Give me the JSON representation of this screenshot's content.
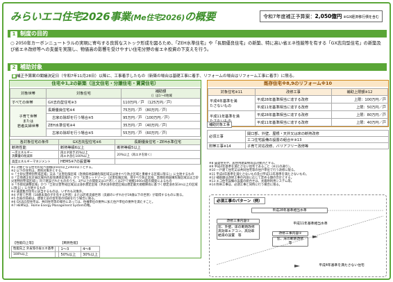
{
  "title": {
    "main": "みらいエコ住宅2026事業",
    "sub": "(Me住宅2026)",
    "tail": "の概要"
  },
  "budget": {
    "label": "令和7年度補正予算案：",
    "amount": "2,050億円",
    "note": "※GX経済移行債を含む"
  },
  "sections": {
    "s1_num": "1",
    "s1": "制度の目的",
    "s2_num": "2",
    "s2": "補助対象"
  },
  "purpose": "○ 2050年カーボンニュートラルの実現に寄与する良質なストック形成を図るため、「ZEH水準住宅」や「長期優良住宅」の新築、特に高い省エネ性能等を有する「GX志向型住宅」の新築及び省エネ改修等への支援を実施し、物価高の影響を受けやすい住宅分野の省エネ投資の下支えを行う。",
  "note1": {
    "tag": "■",
    "text": "補正予算案の閣議決定日（令和7年11月28日）以降に、工事着手したもの（新築の場合は基礎工事に着手、リフォームの場合はリフォーム工事に着手）に限る。"
  },
  "new": {
    "heading": "住宅※1,2の新築（注文住宅・分譲住宅・賃貸住宅）",
    "col1": "対象世帯",
    "col2": "対象住宅",
    "col3": "補助額",
    "col3sub": "（）は1～4地域",
    "rows": [
      {
        "h": "すべての世帯",
        "t": "GX志向型住宅※3",
        "a": "110万円／戸",
        "b": "（125万円／戸）"
      },
      {
        "h": "子育て世帯\nまたは\n若者夫婦世帯",
        "t": "長期優良住宅※4",
        "a": "75万円／戸",
        "b": "（80万円／戸）"
      },
      {
        "h": "",
        "t": "古家の除却を行う場合※5",
        "a": "95万円／戸",
        "b": "（100万円／戸）"
      },
      {
        "h": "",
        "t": "ZEH水準住宅※4",
        "a": "35万円／戸",
        "b": "（40万円／戸）"
      },
      {
        "h": "",
        "t": "古家の除却を行う場合※5",
        "a": "55万円／戸",
        "b": "（60万円／戸）"
      }
    ],
    "cond_head": [
      "各対象住宅の条件",
      "GX志向型住宅※6",
      "長期優良住宅・ZEH水準住宅"
    ],
    "cond_rows": [
      [
        "断熱性能",
        "断熱等級6以上",
        "断熱等級5以上"
      ],
      [
        "一次エネルギー\n消費量の削減率",
        "再エネ除き35%以上\n再エネ含む100%以上",
        "20%以上（再エネを除く）"
      ],
      [
        "高度エネルギーマネジメント",
        "HEMS※7の設置等",
        ""
      ]
    ],
    "notes": "※1 対象となる住宅の延べ面積は50㎡以上240㎡以下とする。\n※2 以下の住宅は、原則対象外とする。\n①「土砂災害特別警戒区域」又は「災害危険区域（急傾斜地崩壊危険区域又は地すべり防止区域と重複する区域に限る）」に立地するもの\n②「立地適正化計画区域内の居住誘導区域外」かつ「災害レッドゾーン（災害危険区域、地すべり防止区域、急傾斜地崩壊危険区域又は土砂災害特別警戒区域）」内で建設されたもののうち、3戸以上の開発又は1戸若しくは2戸で規模1000㎡超の開発によるもの\n③「市街化調整区域」かつ「土砂災害警戒区域又は浸水想定区域（洪水浸水想定区域は想定最大規模降雨に基づく想定浸水深3m以上の区域に限る）」に立地するもの\n※3 賃貸集合住宅に該当するものは、いずれも対象外。\n※4 子育て世帯（18歳未満の子を有する世帯）または若者夫婦世帯（夫婦のいずれかが39歳以下の世帯）が取得するものに限る。\n※5 古家の除却は、建替え前の住宅等の除却を行う場合に限る。\n※6 GX志向型住宅は、共同住宅等の場合にあっては、住棟単位の要件に加え住戸単位の要件を満たすこと。\n※7 HEMSは、Home Energy Management Systemの略。",
    "req_head": [
      "【性能向上等】",
      "",
      "【断熱性能】"
    ],
    "req_rows": [
      [
        "性能向上 外皮等の省エネ基準",
        "",
        "1～3",
        "4～8"
      ],
      [
        "100%以上",
        "",
        "50%以上",
        "30%以上"
      ]
    ]
  },
  "reno": {
    "heading": "既存住宅※8,9のリフォーム※10",
    "col1": "対象住宅※11",
    "col2": "改修工事",
    "col3": "補助上限額※12",
    "rows": [
      {
        "h": "平成4年基準を満\nたさないもの",
        "w": "平成28年基準相当に達する改修",
        "a": "上限：100万円／戸"
      },
      {
        "h": "",
        "w": "平成11年基準相当に達する改修",
        "a": "上限：50万円／戸"
      },
      {
        "h": "平成11年基準を満\nたさないもの",
        "w": "平成28年基準相当に達する改修",
        "a": "上限：80万円／戸"
      },
      {
        "h": "",
        "w": "平成11年基準相当に達する改修",
        "a": "上限：40万円／戸"
      }
    ],
    "req_label": "補助対象工事",
    "req_rows": [
      {
        "k": "必須工事",
        "v": [
          "開口部、外壁、屋根・天井又は床の断熱改修",
          "エコ住宅設備の設置の組合せ※13"
        ]
      },
      {
        "k": "附帯工事※14",
        "v": [
          "子育て対応改修、バリアフリー改修等"
        ]
      }
    ],
    "notes": "※8 賃貸住宅や、居住用建築物等は対象外とする。\n※9 平成4年基準を満たさない住宅であること（※11の通り）。\n※10 一戸建て住宅又は共同住宅等の住戸単位で行う改修に限る。\n※11 平成4年基準を満たさないもの及び平成11年基準を満たさないもの。\n※12 補助額は改修工事の内容に応じて定める額の合計とする。\n※13 エコ住宅設備の設置の組合せは、太陽熱利用システム等。\n※14 附帯工事は、必須工事と同時に行う場合に限る。",
    "pattern": {
      "title": "必須工事のパターン（例）",
      "top": "平成28年基準相当水準",
      "box1_head": "改修工事内容①",
      "box1": "窓、外壁、床の断熱改修\n高効率エアコン、高効率\n給湯の設置　等",
      "box2_head": "改修工事内容②",
      "box2": "窓、床の断熱改修\n等",
      "mid": "平成11年基準相当水準",
      "bottom": "平成4年基準を満たさない住宅"
    }
  },
  "colors": {
    "green": "#5aa637",
    "orange": "#d08a1c"
  }
}
